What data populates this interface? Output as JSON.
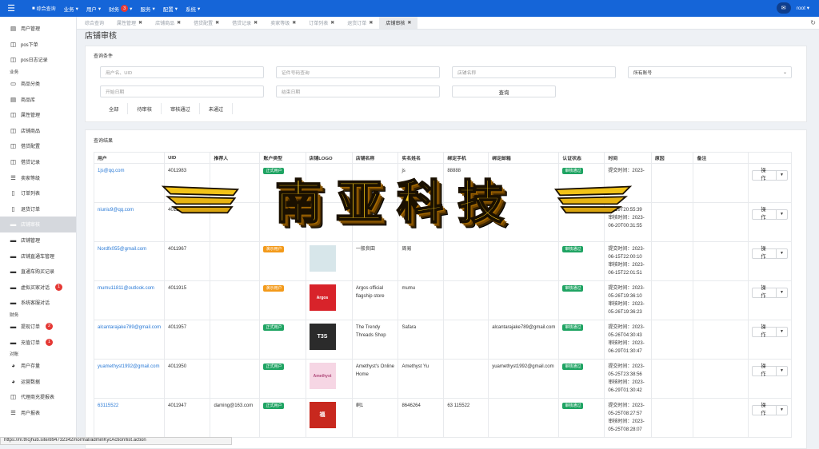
{
  "topbar": {
    "home": "综合查询",
    "menus": [
      {
        "label": "业务",
        "badge": ""
      },
      {
        "label": "用户",
        "badge": ""
      },
      {
        "label": "财务",
        "badge": "3"
      },
      {
        "label": "服务",
        "badge": ""
      },
      {
        "label": "配置",
        "badge": ""
      },
      {
        "label": "系统",
        "badge": ""
      }
    ],
    "user": "root"
  },
  "sidebar": {
    "items": [
      {
        "label": "用户管理",
        "icon": "document-icon"
      },
      {
        "label": "pos下单",
        "icon": "columns-icon"
      },
      {
        "label": "pos日志记录",
        "icon": "columns-icon"
      }
    ],
    "section_business": "业务",
    "business_items": [
      {
        "label": "商品分类",
        "icon": "laptop-icon"
      },
      {
        "label": "商品库",
        "icon": "document-icon"
      },
      {
        "label": "属性管理",
        "icon": "columns-icon"
      },
      {
        "label": "店铺商品",
        "icon": "columns-icon"
      },
      {
        "label": "借贷配置",
        "icon": "columns-icon"
      },
      {
        "label": "借贷记录",
        "icon": "columns-icon"
      },
      {
        "label": "卖家等级",
        "icon": "list-icon"
      },
      {
        "label": "订单列表",
        "icon": "document-icon"
      },
      {
        "label": "退货订单",
        "icon": "document-icon"
      },
      {
        "label": "店铺审核",
        "icon": "card-icon",
        "active": true
      },
      {
        "label": "店铺管理",
        "icon": "card-icon"
      },
      {
        "label": "店铺直通车管理",
        "icon": "card-icon"
      },
      {
        "label": "直通车购买记录",
        "icon": "card-icon"
      },
      {
        "label": "虚拟买家对话",
        "icon": "card-icon",
        "badge": "1"
      },
      {
        "label": "系统客服对话",
        "icon": "card-icon"
      }
    ],
    "section_finance": "财务",
    "finance_items": [
      {
        "label": "提现订单",
        "icon": "card-icon",
        "badge": "2"
      },
      {
        "label": "充值订单",
        "icon": "card-icon",
        "badge": "1"
      }
    ],
    "section_report": "对账",
    "report_items": [
      {
        "label": "用户存量",
        "icon": "pie-icon"
      },
      {
        "label": "运营数据",
        "icon": "pie-icon"
      },
      {
        "label": "代理商充提报表",
        "icon": "columns-icon"
      },
      {
        "label": "用户报表",
        "icon": "list-icon"
      }
    ]
  },
  "tabs": [
    {
      "label": "综合查询",
      "closable": false
    },
    {
      "label": "属性管理",
      "closable": true
    },
    {
      "label": "店铺商品",
      "closable": true
    },
    {
      "label": "借贷配置",
      "closable": true
    },
    {
      "label": "借贷记录",
      "closable": true
    },
    {
      "label": "卖家等级",
      "closable": true
    },
    {
      "label": "订单列表",
      "closable": true
    },
    {
      "label": "退货订单",
      "closable": true
    },
    {
      "label": "店铺审核",
      "closable": true,
      "active": true
    }
  ],
  "page_title": "店铺审核",
  "query": {
    "title": "查询条件",
    "user_placeholder": "用户名、UID",
    "idno_placeholder": "证件号码查询",
    "shop_placeholder": "店铺名称",
    "account_select": "所有账号",
    "start_placeholder": "开始日期",
    "end_placeholder": "结束日期",
    "query_button": "查询",
    "filters": [
      "全部",
      "待审核",
      "审核通过",
      "未通过"
    ]
  },
  "results": {
    "title": "查询结果",
    "columns": [
      "用户",
      "UID",
      "推荐人",
      "账户类型",
      "店铺LOGO",
      "店铺名称",
      "实名姓名",
      "绑定手机",
      "绑定邮箱",
      "认证状态",
      "时间",
      "原因",
      "备注",
      ""
    ],
    "op_label": "操作",
    "rows": [
      {
        "user": "1js@qq.com",
        "uid": "4011983",
        "ref": "",
        "type": "正式用户",
        "type_color": "green",
        "logo": "",
        "logo_color": "#ffffff",
        "shop": "",
        "name": "js",
        "phone": "88888",
        "email": "",
        "status": "审核通过",
        "submit": "提交时间：2023-",
        "review": "",
        "remark": ""
      },
      {
        "user": "niuniu9@qq.com",
        "uid": "4011981",
        "ref": "ail.com",
        "type": "",
        "type_color": "green",
        "logo": "",
        "logo_color": "#ffffff",
        "shop": "",
        "name": "",
        "phone": "",
        "email": "",
        "status": "",
        "submit": "06-19T20:55:39",
        "review": "审核时间：2023-06-20T00:31:55",
        "remark": ""
      },
      {
        "user": "Nordfx055@gmail.com",
        "uid": "4011967",
        "ref": "",
        "type": "演示用户",
        "type_color": "orange",
        "logo": "",
        "logo_color": "#d7e6ea",
        "shop": "一般良田",
        "name": "周易",
        "phone": "",
        "email": "",
        "status": "审核通过",
        "submit": "提交时间：2023-06-15T22:00:10",
        "review": "审核时间：2023-06-15T22:01:51",
        "remark": ""
      },
      {
        "user": "mumu11811@outlook.com",
        "uid": "4011915",
        "ref": "",
        "type": "演示用户",
        "type_color": "orange",
        "logo": "Argos",
        "logo_color": "#d8232a",
        "shop": "Argos official flagship store",
        "name": "mumu",
        "phone": "",
        "email": "",
        "status": "审核通过",
        "submit": "提交时间：2023-05-26T19:36:10",
        "review": "审核时间：2023-05-26T19:36:23",
        "remark": ""
      },
      {
        "user": "alcantarajake789@gmail.com",
        "uid": "4011957",
        "ref": "",
        "type": "正式用户",
        "type_color": "green",
        "logo": "T3S",
        "logo_color": "#2b2b2b",
        "shop": "The Trendy Threads Shop",
        "name": "Safara",
        "phone": "",
        "email": "alcantarajake789@gmail.com",
        "status": "审核通过",
        "submit": "提交时间：2023-05-26T04:30:43",
        "review": "审核时间：2023-06-29T01:30:47",
        "remark": ""
      },
      {
        "user": "yuamethyst1992@gmail.com",
        "uid": "4011950",
        "ref": "",
        "type": "正式用户",
        "type_color": "green",
        "logo": "Amethyst",
        "logo_color": "#f6d6e4",
        "shop": "Amethyst's Online Home",
        "name": "Amethyst Yu",
        "phone": "",
        "email": "yuamethyst1992@gmail.com",
        "status": "审核通过",
        "submit": "提交时间：2023-05-25T23:38:56",
        "review": "审核时间：2023-06-29T01:30:42",
        "remark": ""
      },
      {
        "user": "63115522",
        "uid": "4011947",
        "ref": "daming@163.com",
        "type": "正式用户",
        "type_color": "green",
        "logo": "福",
        "logo_color": "#c8281e",
        "shop": "峒1",
        "name": "8646264",
        "phone": "63 115522",
        "email": "",
        "status": "审核通过",
        "submit": "提交时间：2023-05-25T08:27:57",
        "review": "审核时间：2023-05-25T08:28:07",
        "remark": ""
      }
    ]
  },
  "watermark": "南亚科技",
  "status_url": "https://nl.thcjhub.site/894732342/normal/adminKycAction!list.action"
}
